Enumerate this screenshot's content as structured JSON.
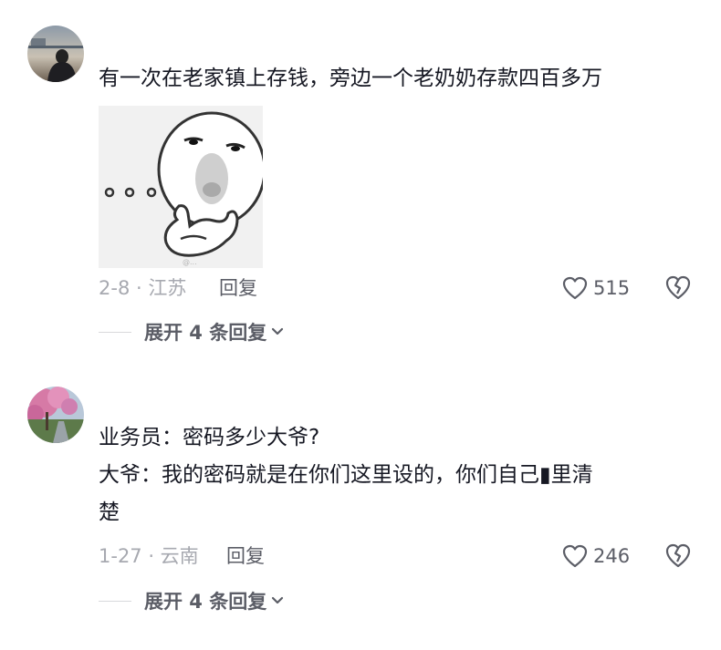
{
  "comments": [
    {
      "text_lines": [
        "有一次在老家镇上存钱，旁边一个老奶奶存款四百多万"
      ],
      "sticker_name": "thinking-face-sticker",
      "date_location": "2-8 · 江苏",
      "reply_label": "回复",
      "like_count": "515",
      "expand_label": "展开 4 条回复"
    },
    {
      "text_lines": [
        "业务员：密码多少大爷?",
        "大爷：我的密码就是在你们这里设的，你们自己▮里清",
        "楚"
      ],
      "date_location": "1-27 · 云南",
      "reply_label": "回复",
      "like_count": "246",
      "expand_label": "展开 4 条回复"
    }
  ],
  "icons": {
    "like": "heart-icon",
    "dislike": "broken-heart-icon",
    "expand": "chevron-down-icon"
  },
  "colors": {
    "text_primary": "#161823",
    "text_secondary": "#a7a9b0",
    "action_text": "#5b5d66"
  }
}
